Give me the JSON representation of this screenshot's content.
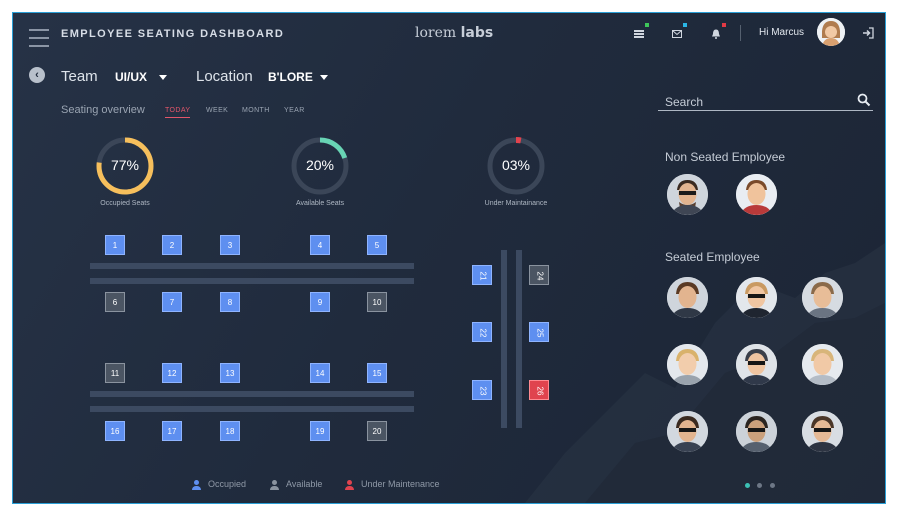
{
  "header": {
    "title": "EMPLOYEE SEATING DASHBOARD",
    "brand_light": "lorem",
    "brand_bold": "labs",
    "greeting": "Hi Marcus",
    "icons": [
      "list-icon",
      "mail-icon",
      "bell-icon",
      "logout-icon"
    ],
    "badge_colors": {
      "list": "#3ec65a",
      "mail": "#2ab6e6",
      "bell": "#e23a45"
    }
  },
  "filters": {
    "team_label": "Team",
    "team_value": "UI/UX",
    "location_label": "Location",
    "location_value": "B'LORE"
  },
  "overview": {
    "title": "Seating  overview",
    "periods": [
      "TODAY",
      "WEEK",
      "MONTH",
      "YEAR"
    ],
    "active_period": "TODAY"
  },
  "gauges": [
    {
      "value": "77%",
      "fraction": 0.77,
      "label": "Occupied Seats",
      "color": "#f6bf5c"
    },
    {
      "value": "20%",
      "fraction": 0.2,
      "label": "Available Seats",
      "color": "#68d4b4"
    },
    {
      "value": "03%",
      "fraction": 0.03,
      "label": "Under Maintainance",
      "color": "#e2434e"
    }
  ],
  "seats": [
    {
      "n": "1",
      "status": "occupied"
    },
    {
      "n": "2",
      "status": "occupied"
    },
    {
      "n": "3",
      "status": "occupied"
    },
    {
      "n": "4",
      "status": "occupied"
    },
    {
      "n": "5",
      "status": "occupied"
    },
    {
      "n": "6",
      "status": "available"
    },
    {
      "n": "7",
      "status": "occupied"
    },
    {
      "n": "8",
      "status": "occupied"
    },
    {
      "n": "9",
      "status": "occupied"
    },
    {
      "n": "10",
      "status": "available"
    },
    {
      "n": "11",
      "status": "available"
    },
    {
      "n": "12",
      "status": "occupied"
    },
    {
      "n": "13",
      "status": "occupied"
    },
    {
      "n": "14",
      "status": "occupied"
    },
    {
      "n": "15",
      "status": "occupied"
    },
    {
      "n": "16",
      "status": "occupied"
    },
    {
      "n": "17",
      "status": "occupied"
    },
    {
      "n": "18",
      "status": "occupied"
    },
    {
      "n": "19",
      "status": "occupied"
    },
    {
      "n": "20",
      "status": "available"
    },
    {
      "n": "21",
      "status": "occupied"
    },
    {
      "n": "22",
      "status": "occupied"
    },
    {
      "n": "23",
      "status": "occupied"
    },
    {
      "n": "24",
      "status": "available"
    },
    {
      "n": "25",
      "status": "occupied"
    },
    {
      "n": "26",
      "status": "maintenance"
    }
  ],
  "legend": {
    "occupied": "Occupied",
    "available": "Available",
    "maintenance": "Under Maintenance",
    "colors": {
      "occupied": "#5e8ff0",
      "available": "#8a939f",
      "maintenance": "#e0434e"
    }
  },
  "search": {
    "placeholder": "Search"
  },
  "non_seated": {
    "title": "Non Seated Employee"
  },
  "seated": {
    "title": "Seated Employee"
  },
  "pagination": {
    "pages": 3,
    "active": 1
  }
}
